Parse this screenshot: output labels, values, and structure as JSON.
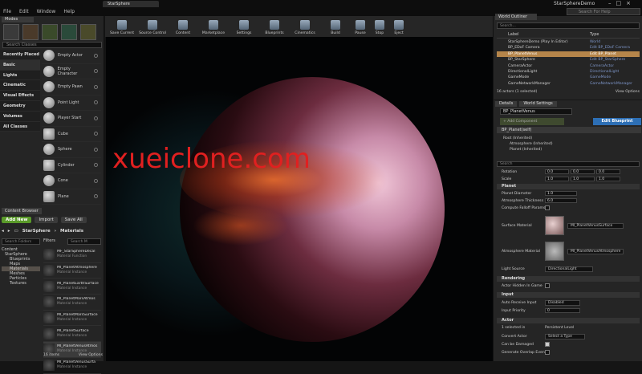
{
  "window": {
    "menus": [
      "File",
      "Edit",
      "Window",
      "Help"
    ],
    "doc_tab": "StarSphere",
    "title": "StarSphereDemo",
    "help_search": "Search For Help"
  },
  "modes": {
    "tab": "Modes",
    "search_placeholder": "Search Classes",
    "categories": [
      "Recently Placed",
      "Basic",
      "Lights",
      "Cinematic",
      "Visual Effects",
      "Geometry",
      "Volumes",
      "All Classes"
    ],
    "items": [
      "Empty Actor",
      "Empty Character",
      "Empty Pawn",
      "Point Light",
      "Player Start",
      "Cube",
      "Sphere",
      "Cylinder",
      "Cone",
      "Plane"
    ]
  },
  "toolbar": {
    "buttons": [
      "Save Current",
      "Source Control",
      "Content",
      "Marketplace",
      "Settings",
      "Blueprints",
      "Cinematics",
      "Build",
      "Pause",
      "Stop",
      "Eject"
    ]
  },
  "viewport": {
    "watermark": "xueiclone.com"
  },
  "content_browser": {
    "tab": "Content Browser",
    "add_new": "Add New",
    "import": "Import",
    "save_all": "Save All",
    "path": [
      "StarSphere",
      "Materials"
    ],
    "search_folders_placeholder": "Search Folders",
    "filters": "Filters",
    "search_assets_placeholder": "Search M",
    "tree": [
      "Content",
      "StarSphere",
      "Blueprints",
      "Maps",
      "Materials",
      "Meshes",
      "Particles",
      "Textures"
    ],
    "assets": [
      {
        "name": "MF_StarSphereDecal",
        "type": "Material Function"
      },
      {
        "name": "MI_PlanetAtmosphere",
        "type": "Material Instance"
      },
      {
        "name": "MI_PlanetEarthSurface",
        "type": "Material Instance"
      },
      {
        "name": "MI_PlanetMarsAtmos",
        "type": "Material Instance"
      },
      {
        "name": "MI_PlanetMarsSurface",
        "type": "Material Instance"
      },
      {
        "name": "MI_PlanetSurface",
        "type": "Material Instance"
      },
      {
        "name": "MI_PlanetVenusAtmos",
        "type": "Material Instance"
      },
      {
        "name": "MI_PlanetVenusSurfa",
        "type": "Material Instance"
      }
    ],
    "items_count": "16 items",
    "view_options": "View Options"
  },
  "world_outliner": {
    "tab": "World Outliner",
    "search_placeholder": "Search...",
    "col_label": "Label",
    "col_type": "Type",
    "rows": [
      {
        "label": "StarSphereDemo (Play In Editor)",
        "type": "World"
      },
      {
        "label": "BP_EDoF Camera",
        "type": "Edit BP_EDoF Camera"
      },
      {
        "label": "BP_PlanetVenus",
        "type": "Edit BP_Planet"
      },
      {
        "label": "BP_StarSphere",
        "type": "Edit BP_StarSphere"
      },
      {
        "label": "CameraActor",
        "type": "CameraActor"
      },
      {
        "label": "DirectionalLight",
        "type": "DirectionalLight"
      },
      {
        "label": "GameMode",
        "type": "GameMode"
      },
      {
        "label": "GameNetworkManager",
        "type": "GameNetworkManager"
      }
    ],
    "status": "16 actors (1 selected)",
    "view_options": "View Options"
  },
  "details": {
    "tabs": [
      "Details",
      "World Settings"
    ],
    "actor_name": "BP_PlanetVenus",
    "add_component": "+ Add Component",
    "edit_blueprint": "Edit Blueprint",
    "self": "BP_Planet(self)",
    "components": [
      "Root (Inherited)",
      "Atmosphere (Inherited)",
      "Planet (Inherited)"
    ],
    "search_placeholder": "Search",
    "rotation_label": "Rotation",
    "rotation": [
      "0.0",
      "0.0",
      "0.0"
    ],
    "scale_label": "Scale",
    "scale": [
      "1.0",
      "1.0",
      "1.0"
    ],
    "planet_section": "Planet",
    "planet_diameter_label": "Planet Diameter",
    "planet_diameter": "1.0",
    "atmo_thickness_label": "Atmosphere Thickness",
    "atmo_thickness": "6.0",
    "compute_falloff_label": "Compute Falloff Params",
    "surface_material_label": "Surface Material",
    "surface_material": "MI_PlanetVenusSurface",
    "atmosphere_material_label": "Atmosphere Material",
    "atmosphere_material": "MI_PlanetVenusAtmosphere",
    "light_source_label": "Light Source",
    "light_source": "DirectionalLight",
    "rendering_section": "Rendering",
    "actor_hidden_label": "Actor Hidden In Game",
    "input_section": "Input",
    "auto_receive_label": "Auto Receive Input",
    "auto_receive": "Disabled",
    "input_priority_label": "Input Priority",
    "input_priority": "0",
    "actor_section": "Actor",
    "selected_in_label": "1 selected in",
    "selected_in": "Persistent Level",
    "convert_actor_label": "Convert Actor",
    "convert_actor": "Select a Type",
    "can_be_damaged_label": "Can be Damaged",
    "gen_overlap_label": "Generate Overlap Events"
  }
}
